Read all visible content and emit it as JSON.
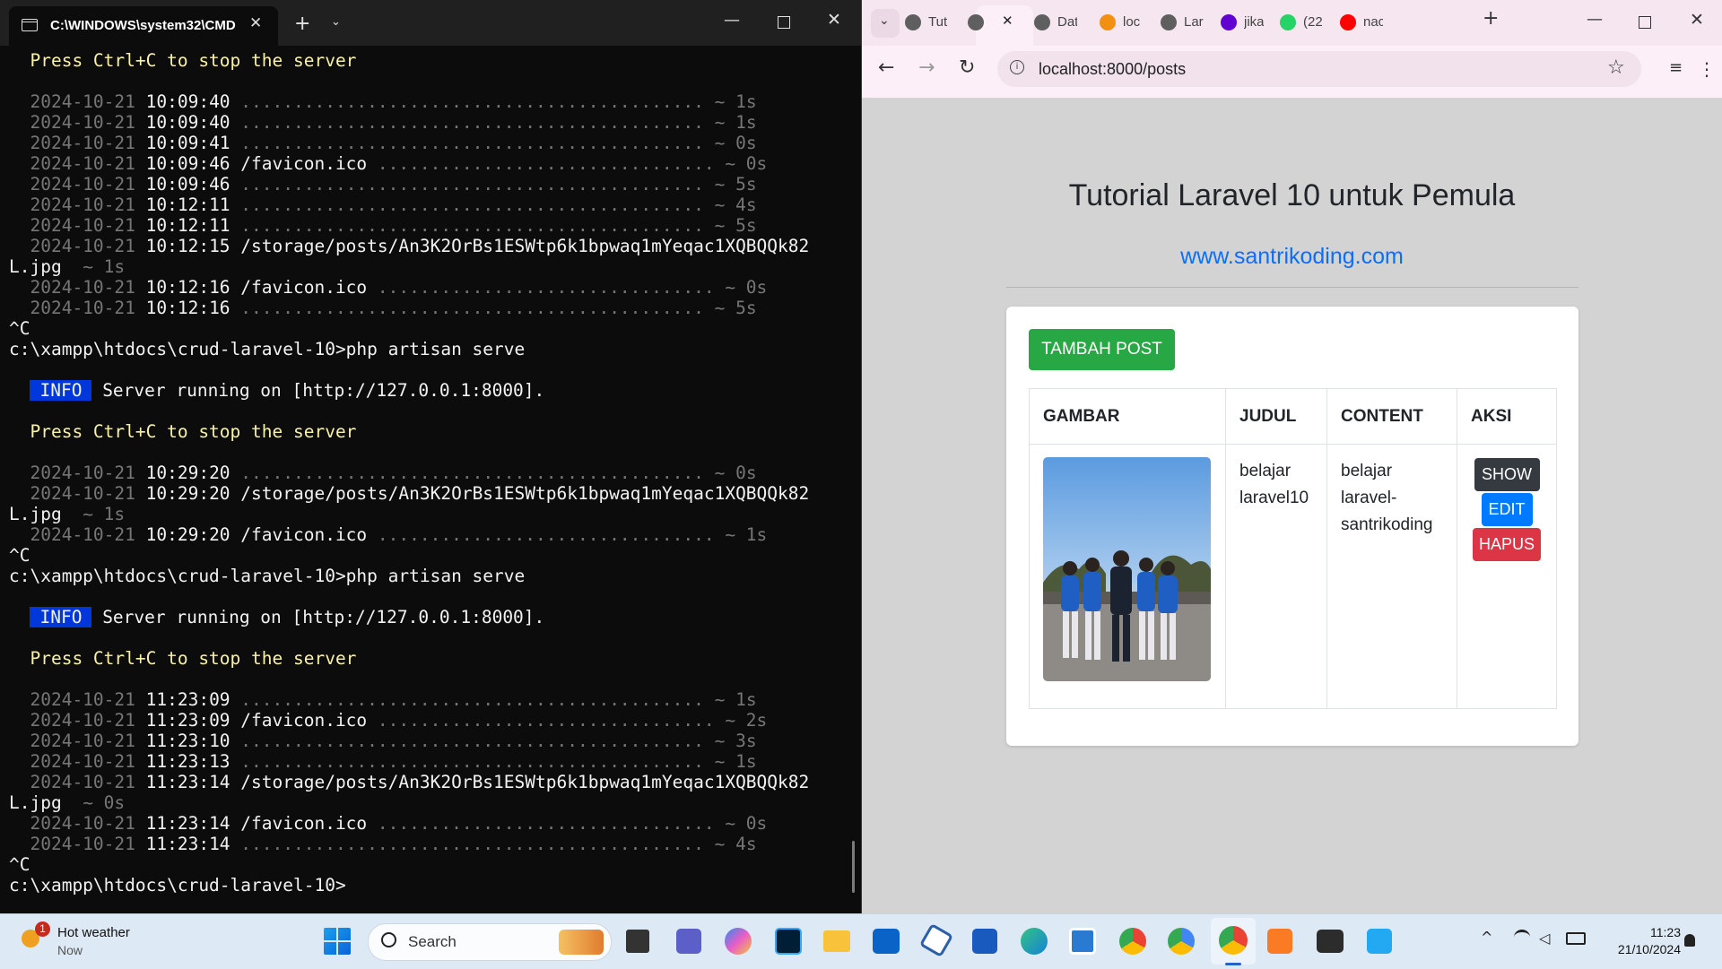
{
  "terminal": {
    "tab_title": "C:\\WINDOWS\\system32\\CMD",
    "lines": [
      {
        "segs": [
          {
            "t": "  Press Ctrl+C to stop the server",
            "c": "c-yellow"
          }
        ]
      },
      {
        "segs": []
      },
      {
        "segs": [
          {
            "t": "  2024-10-21 ",
            "c": "c-gray"
          },
          {
            "t": "10:09:40 ",
            "c": "c-white"
          },
          {
            "t": "............................................ ~ 1s",
            "c": "c-gray"
          }
        ]
      },
      {
        "segs": [
          {
            "t": "  2024-10-21 ",
            "c": "c-gray"
          },
          {
            "t": "10:09:40 ",
            "c": "c-white"
          },
          {
            "t": "............................................ ~ 1s",
            "c": "c-gray"
          }
        ]
      },
      {
        "segs": [
          {
            "t": "  2024-10-21 ",
            "c": "c-gray"
          },
          {
            "t": "10:09:41 ",
            "c": "c-white"
          },
          {
            "t": "............................................ ~ 0s",
            "c": "c-gray"
          }
        ]
      },
      {
        "segs": [
          {
            "t": "  2024-10-21 ",
            "c": "c-gray"
          },
          {
            "t": "10:09:46 /favicon.ico ",
            "c": "c-white"
          },
          {
            "t": "................................ ~ 0s",
            "c": "c-gray"
          }
        ]
      },
      {
        "segs": [
          {
            "t": "  2024-10-21 ",
            "c": "c-gray"
          },
          {
            "t": "10:09:46 ",
            "c": "c-white"
          },
          {
            "t": "............................................ ~ 5s",
            "c": "c-gray"
          }
        ]
      },
      {
        "segs": [
          {
            "t": "  2024-10-21 ",
            "c": "c-gray"
          },
          {
            "t": "10:12:11 ",
            "c": "c-white"
          },
          {
            "t": "............................................ ~ 4s",
            "c": "c-gray"
          }
        ]
      },
      {
        "segs": [
          {
            "t": "  2024-10-21 ",
            "c": "c-gray"
          },
          {
            "t": "10:12:11 ",
            "c": "c-white"
          },
          {
            "t": "............................................ ~ 5s",
            "c": "c-gray"
          }
        ]
      },
      {
        "segs": [
          {
            "t": "  2024-10-21 ",
            "c": "c-gray"
          },
          {
            "t": "10:12:15 /storage/posts/An3K2OrBs1ESWtp6k1bpwaq1mYeqac1XQBQQk82",
            "c": "c-white"
          }
        ]
      },
      {
        "segs": [
          {
            "t": "L.jpg ",
            "c": "c-white"
          },
          {
            "t": " ~ 1s",
            "c": "c-gray"
          }
        ]
      },
      {
        "segs": [
          {
            "t": "  2024-10-21 ",
            "c": "c-gray"
          },
          {
            "t": "10:12:16 /favicon.ico ",
            "c": "c-white"
          },
          {
            "t": "................................ ~ 0s",
            "c": "c-gray"
          }
        ]
      },
      {
        "segs": [
          {
            "t": "  2024-10-21 ",
            "c": "c-gray"
          },
          {
            "t": "10:12:16 ",
            "c": "c-white"
          },
          {
            "t": "............................................ ~ 5s",
            "c": "c-gray"
          }
        ]
      },
      {
        "segs": [
          {
            "t": "^C",
            "c": "c-white"
          }
        ]
      },
      {
        "segs": [
          {
            "t": "c:\\xampp\\htdocs\\crud-laravel-10>php artisan serve",
            "c": "c-white"
          }
        ]
      },
      {
        "segs": []
      },
      {
        "segs": [
          {
            "t": "  ",
            "c": ""
          },
          {
            "t": "INFO",
            "c": "info-badge"
          },
          {
            "t": " Server running on ",
            "c": "c-white"
          },
          {
            "t": "[http://127.0.0.1:8000]",
            "c": "c-white"
          },
          {
            "t": ".",
            "c": "c-white"
          }
        ]
      },
      {
        "segs": []
      },
      {
        "segs": [
          {
            "t": "  Press Ctrl+C to stop the server",
            "c": "c-yellow"
          }
        ]
      },
      {
        "segs": []
      },
      {
        "segs": [
          {
            "t": "  2024-10-21 ",
            "c": "c-gray"
          },
          {
            "t": "10:29:20 ",
            "c": "c-white"
          },
          {
            "t": "............................................ ~ 0s",
            "c": "c-gray"
          }
        ]
      },
      {
        "segs": [
          {
            "t": "  2024-10-21 ",
            "c": "c-gray"
          },
          {
            "t": "10:29:20 /storage/posts/An3K2OrBs1ESWtp6k1bpwaq1mYeqac1XQBQQk82",
            "c": "c-white"
          }
        ]
      },
      {
        "segs": [
          {
            "t": "L.jpg ",
            "c": "c-white"
          },
          {
            "t": " ~ 1s",
            "c": "c-gray"
          }
        ]
      },
      {
        "segs": [
          {
            "t": "  2024-10-21 ",
            "c": "c-gray"
          },
          {
            "t": "10:29:20 /favicon.ico ",
            "c": "c-white"
          },
          {
            "t": "................................ ~ 1s",
            "c": "c-gray"
          }
        ]
      },
      {
        "segs": [
          {
            "t": "^C",
            "c": "c-white"
          }
        ]
      },
      {
        "segs": [
          {
            "t": "c:\\xampp\\htdocs\\crud-laravel-10>php artisan serve",
            "c": "c-white"
          }
        ]
      },
      {
        "segs": []
      },
      {
        "segs": [
          {
            "t": "  ",
            "c": ""
          },
          {
            "t": "INFO",
            "c": "info-badge"
          },
          {
            "t": " Server running on ",
            "c": "c-white"
          },
          {
            "t": "[http://127.0.0.1:8000]",
            "c": "c-white"
          },
          {
            "t": ".",
            "c": "c-white"
          }
        ]
      },
      {
        "segs": []
      },
      {
        "segs": [
          {
            "t": "  Press Ctrl+C to stop the server",
            "c": "c-yellow"
          }
        ]
      },
      {
        "segs": []
      },
      {
        "segs": [
          {
            "t": "  2024-10-21 ",
            "c": "c-gray"
          },
          {
            "t": "11:23:09 ",
            "c": "c-white"
          },
          {
            "t": "............................................ ~ 1s",
            "c": "c-gray"
          }
        ]
      },
      {
        "segs": [
          {
            "t": "  2024-10-21 ",
            "c": "c-gray"
          },
          {
            "t": "11:23:09 /favicon.ico ",
            "c": "c-white"
          },
          {
            "t": "................................ ~ 2s",
            "c": "c-gray"
          }
        ]
      },
      {
        "segs": [
          {
            "t": "  2024-10-21 ",
            "c": "c-gray"
          },
          {
            "t": "11:23:10 ",
            "c": "c-white"
          },
          {
            "t": "............................................ ~ 3s",
            "c": "c-gray"
          }
        ]
      },
      {
        "segs": [
          {
            "t": "  2024-10-21 ",
            "c": "c-gray"
          },
          {
            "t": "11:23:13 ",
            "c": "c-white"
          },
          {
            "t": "............................................ ~ 1s",
            "c": "c-gray"
          }
        ]
      },
      {
        "segs": [
          {
            "t": "  2024-10-21 ",
            "c": "c-gray"
          },
          {
            "t": "11:23:14 /storage/posts/An3K2OrBs1ESWtp6k1bpwaq1mYeqac1XQBQQk82",
            "c": "c-white"
          }
        ]
      },
      {
        "segs": [
          {
            "t": "L.jpg ",
            "c": "c-white"
          },
          {
            "t": " ~ 0s",
            "c": "c-gray"
          }
        ]
      },
      {
        "segs": [
          {
            "t": "  2024-10-21 ",
            "c": "c-gray"
          },
          {
            "t": "11:23:14 /favicon.ico ",
            "c": "c-white"
          },
          {
            "t": "................................ ~ 0s",
            "c": "c-gray"
          }
        ]
      },
      {
        "segs": [
          {
            "t": "  2024-10-21 ",
            "c": "c-gray"
          },
          {
            "t": "11:23:14 ",
            "c": "c-white"
          },
          {
            "t": "............................................ ~ 4s",
            "c": "c-gray"
          }
        ]
      },
      {
        "segs": [
          {
            "t": "^C",
            "c": "c-white"
          }
        ]
      },
      {
        "segs": [
          {
            "t": "c:\\xampp\\htdocs\\crud-laravel-10>",
            "c": "c-white"
          }
        ]
      }
    ]
  },
  "browser": {
    "tabs": [
      {
        "label": "Tut",
        "icon": "globe-icon",
        "color": "#5f5f5f"
      },
      {
        "label": "",
        "icon": "globe-icon",
        "color": "#5f5f5f",
        "active": true
      },
      {
        "label": "Dat",
        "icon": "globe-icon",
        "color": "#5f5f5f"
      },
      {
        "label": "loc",
        "icon": "phpmyadmin-icon",
        "color": "#f29111"
      },
      {
        "label": "Lar",
        "icon": "globe-icon",
        "color": "#5f5f5f"
      },
      {
        "label": "jika",
        "icon": "yahoo-icon",
        "color": "#6001d2"
      },
      {
        "label": "(22",
        "icon": "whatsapp-icon",
        "color": "#25d366"
      },
      {
        "label": "nac",
        "icon": "youtube-icon",
        "color": "#ff0000"
      }
    ],
    "url": "localhost:8000/posts",
    "page": {
      "heading": "Tutorial Laravel 10 untuk Pemula",
      "link": "www.santrikoding.com",
      "add_button": "TAMBAH POST",
      "columns": [
        "GAMBAR",
        "JUDUL",
        "CONTENT",
        "AKSI"
      ],
      "rows": [
        {
          "judul": "belajar laravel10",
          "content": "belajar laravel-santrikoding",
          "actions": {
            "show": "SHOW",
            "edit": "EDIT",
            "hapus": "HAPUS"
          }
        }
      ]
    }
  },
  "taskbar": {
    "weather_title": "Hot weather",
    "weather_sub": "Now",
    "weather_badge": "1",
    "search_placeholder": "Search",
    "time": "11:23",
    "date": "21/10/2024",
    "apps": [
      "start-icon",
      "search",
      "task-view-icon",
      "teams-icon",
      "copilot-icon",
      "photoshop-icon",
      "file-explorer-icon",
      "outlook-icon",
      "vpn-icon",
      "word-icon",
      "edge-icon",
      "app-icon",
      "chrome-icon",
      "chrome-icon",
      "chrome-active-icon",
      "xampp-icon",
      "terminal-icon",
      "vscode-icon"
    ]
  }
}
